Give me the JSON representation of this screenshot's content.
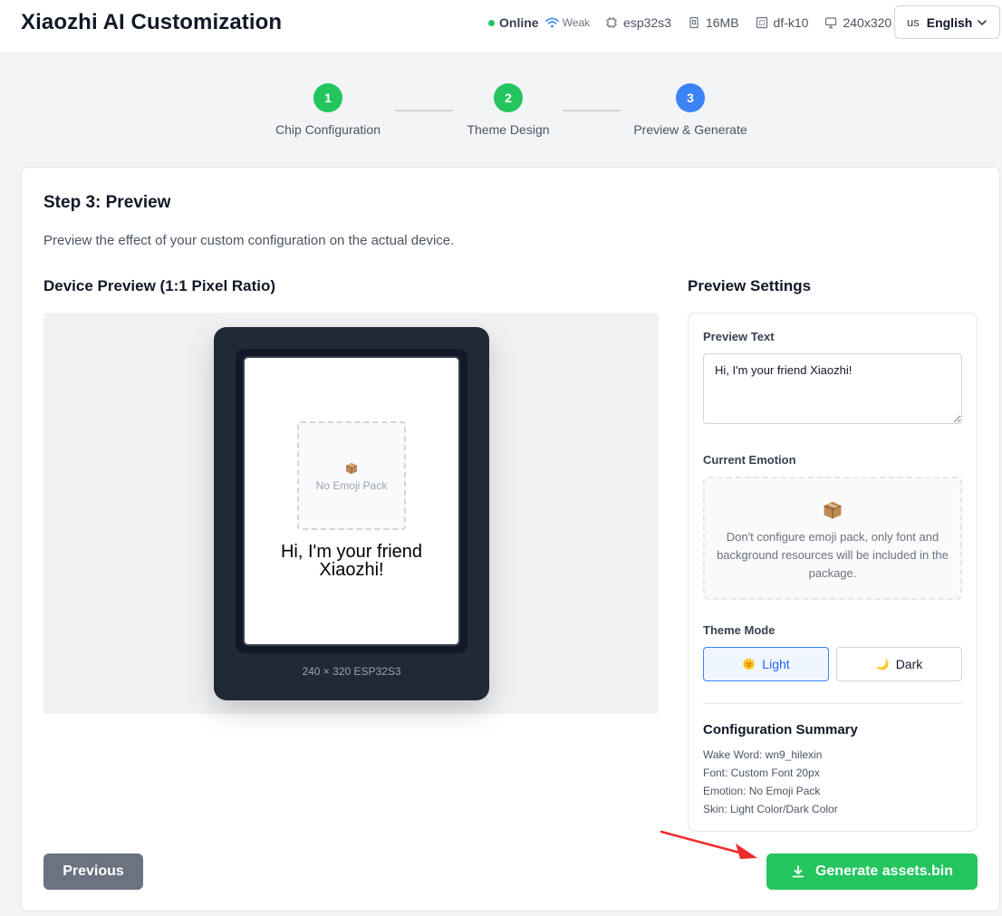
{
  "header": {
    "title": "Xiaozhi AI Customization",
    "status_online": "Online",
    "signal": "Weak",
    "chip": "esp32s3",
    "flash": "16MB",
    "board": "df-k10",
    "resolution": "240x320",
    "language_flag": "us",
    "language": "English"
  },
  "steps": [
    {
      "number": "1",
      "label": "Chip Configuration",
      "state": "done"
    },
    {
      "number": "2",
      "label": "Theme Design",
      "state": "done"
    },
    {
      "number": "3",
      "label": "Preview & Generate",
      "state": "active"
    }
  ],
  "colors": {
    "done": "#22c55e",
    "active": "#3b82f6"
  },
  "card": {
    "heading": "Step 3: Preview",
    "description": "Preview the effect of your custom configuration on the actual device."
  },
  "device_preview": {
    "heading": "Device Preview (1:1 Pixel Ratio)",
    "emoji_placeholder": "No Emoji Pack",
    "screen_text": "Hi, I'm your friend Xiaozhi!",
    "caption": "240 × 320 ESP32S3"
  },
  "settings": {
    "heading": "Preview Settings",
    "preview_text_label": "Preview Text",
    "preview_text_value": "Hi, I'm your friend Xiaozhi!",
    "emotion_label": "Current Emotion",
    "emotion_message": "Don't configure emoji pack, only font and background resources will be included in the package.",
    "theme_mode_label": "Theme Mode",
    "light_emoji": "🌞",
    "light_label": "Light",
    "dark_emoji": "🌙",
    "dark_label": "Dark",
    "selected_mode": "Light",
    "summary_title": "Configuration Summary",
    "summary": [
      "Wake Word: wn9_hilexin",
      "Font: Custom Font 20px",
      "Emotion: No Emoji Pack",
      "Skin: Light Color/Dark Color"
    ]
  },
  "actions": {
    "previous": "Previous",
    "generate": "Generate assets.bin"
  }
}
